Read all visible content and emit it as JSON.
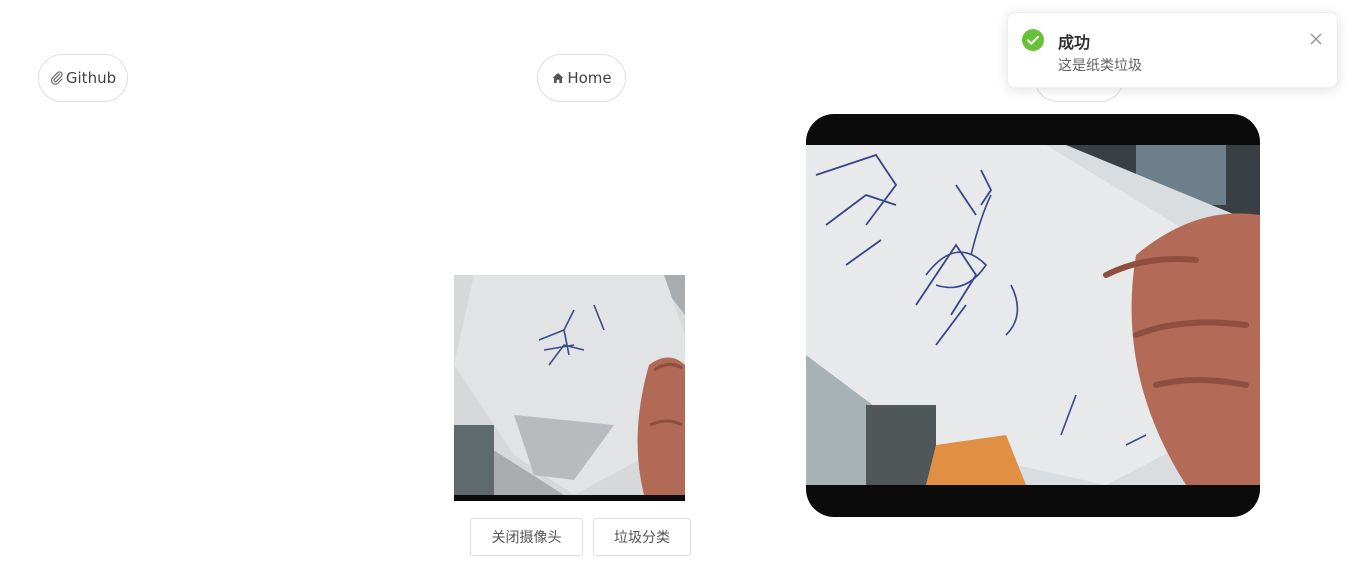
{
  "nav": {
    "github_label": "Github",
    "home_label": "Home",
    "github_icon": "paperclip-icon",
    "home_icon": "home-icon"
  },
  "controls": {
    "close_camera_label": "关闭摄像头",
    "classify_label": "垃圾分类"
  },
  "toast": {
    "title": "成功",
    "message": "这是纸类垃圾",
    "status_color": "#67c23a",
    "icon": "check-circle-icon"
  }
}
